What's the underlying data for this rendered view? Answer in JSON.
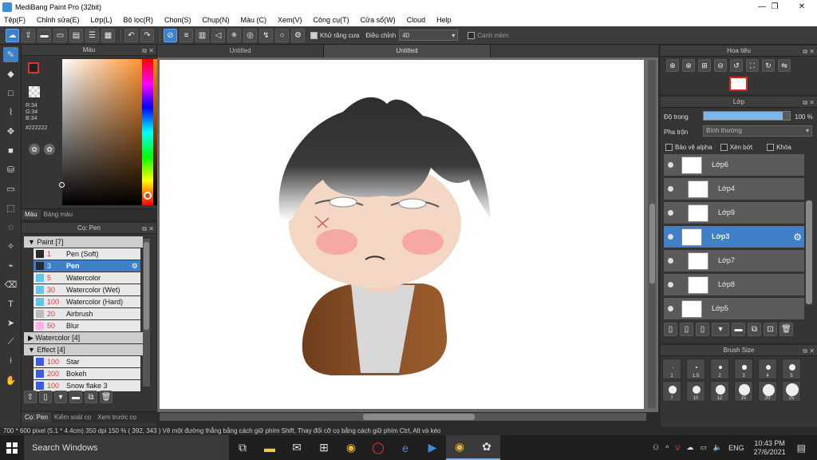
{
  "window": {
    "title": "MediBang Paint Pro (32bit)",
    "minimize": "—",
    "maximize": "❐",
    "close": "✕"
  },
  "menu": [
    "Tệp(F)",
    "Chỉnh sửa(E)",
    "Lớp(L)",
    "Bộ lọc(R)",
    "Chọn(S)",
    "Chụp(N)",
    "Màu (C)",
    "Xem(V)",
    "Công cụ(T)",
    "Cửa sổ(W)",
    "Cloud",
    "Help"
  ],
  "toolbar": {
    "antialias_label": "Khử răng cưa",
    "correction_label": "Điều chỉnh",
    "correction_value": "40",
    "snap_label": "Canh mềm"
  },
  "color_panel": {
    "title": "Màu",
    "r": "R:34",
    "g": "G:34",
    "b": "B:34",
    "hex": "#222222",
    "tab_color": "Màu",
    "tab_palette": "Bảng màu",
    "primary_color": "#222222",
    "secondary_color": "#6b4fa0"
  },
  "brush_panel": {
    "title": "Cọ: Pen",
    "groups": [
      {
        "name": "Paint [7]",
        "items": [
          {
            "size": "1",
            "name": "Pen (Soft)",
            "color": "#2a2a2a"
          },
          {
            "size": "3",
            "name": "Pen",
            "color": "#2a2a2a"
          },
          {
            "size": "5",
            "name": "Watercolor",
            "color": "#5ac8ee"
          },
          {
            "size": "30",
            "name": "Watercolor (Wet)",
            "color": "#5ac8ee"
          },
          {
            "size": "100",
            "name": "Watercolor (Hard)",
            "color": "#5ac8ee"
          },
          {
            "size": "20",
            "name": "Airbrush",
            "color": "#bbbbbb"
          },
          {
            "size": "50",
            "name": "Blur",
            "color": "#ffb0e8"
          }
        ]
      },
      {
        "name": "Watercolor [4]",
        "items": []
      },
      {
        "name": "Effect [4]",
        "items": [
          {
            "size": "100",
            "name": "Star",
            "color": "#3a5ae8"
          },
          {
            "size": "200",
            "name": "Bokeh",
            "color": "#3a5ae8"
          },
          {
            "size": "100",
            "name": "Snow flake 3",
            "color": "#3a5ae8"
          }
        ]
      }
    ],
    "tab_brush": "Cọ: Pen",
    "tab_material": "Kiểm soát cọ",
    "tab_preview": "Xem trước cọ"
  },
  "doc_tabs": [
    "Untitled",
    "Untitled"
  ],
  "status": {
    "text": "700 * 600 pixel   (5.1 * 4.4cm)   350 dpi   150 %   ( 392, 343 )   Vẽ một đường thẳng bằng cách giữ phím Shift, Thay đổi cỡ cọ bằng cách giữ phím Ctrl, Alt và kéo"
  },
  "navigator": {
    "title": "Hoa tiêu"
  },
  "layer_panel": {
    "title": "Lớp",
    "opacity_label": "Độ trong",
    "opacity_value": "100 %",
    "opacity": 0.92,
    "blend_label": "Pha trộn",
    "blend_value": "Bình thường",
    "protect_alpha": "Bảo vệ alpha",
    "clipping": "Xén bớt",
    "lock": "Khóa",
    "layers": [
      {
        "name": "Lớp6",
        "indent": false,
        "selected": false
      },
      {
        "name": "Lớp4",
        "indent": true,
        "selected": false
      },
      {
        "name": "Lớp9",
        "indent": true,
        "selected": false
      },
      {
        "name": "Lớp3",
        "indent": false,
        "selected": true
      },
      {
        "name": "Lớp7",
        "indent": true,
        "selected": false
      },
      {
        "name": "Lớp8",
        "indent": true,
        "selected": false
      },
      {
        "name": "Lớp5",
        "indent": false,
        "selected": false
      }
    ]
  },
  "brush_size": {
    "title": "Brush Size",
    "sizes": [
      "1",
      "1.5",
      "2",
      "3",
      "4",
      "5",
      "7",
      "10",
      "12",
      "15",
      "20",
      "25"
    ]
  },
  "taskbar": {
    "search_placeholder": "Search Windows",
    "time": "10:43 PM",
    "date": "27/6/2021",
    "lang": "ENG"
  }
}
